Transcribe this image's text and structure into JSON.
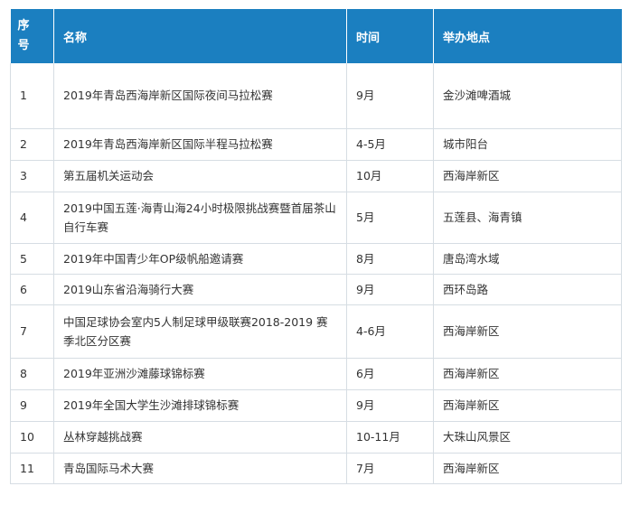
{
  "table": {
    "headers": [
      "序\n号",
      "名称",
      "时间",
      "举办地点"
    ],
    "rows": [
      {
        "no": "1",
        "name": "2019年青岛西海岸新区国际夜间马拉松赛",
        "time": "9月",
        "place": "金沙滩啤酒城"
      },
      {
        "no": "2",
        "name": "2019年青岛西海岸新区国际半程马拉松赛",
        "time": "4-5月",
        "place": "城市阳台"
      },
      {
        "no": "3",
        "name": "第五届机关运动会",
        "time": "10月",
        "place": "西海岸新区"
      },
      {
        "no": "4",
        "name": "2019中国五莲·海青山海24小时极限挑战赛暨首届茶山自行车赛",
        "time": "5月",
        "place": "五莲县、海青镇"
      },
      {
        "no": "5",
        "name": "2019年中国青少年OP级帆船邀请赛",
        "time": "8月",
        "place": "唐岛湾水域"
      },
      {
        "no": "6",
        "name": "2019山东省沿海骑行大赛",
        "time": "9月",
        "place": "西环岛路"
      },
      {
        "no": "7",
        "name": "中国足球协会室内5人制足球甲级联赛2018-2019 赛季北区分区赛",
        "time": "4-6月",
        "place": "西海岸新区"
      },
      {
        "no": "8",
        "name": "2019年亚洲沙滩藤球锦标赛",
        "time": "6月",
        "place": "西海岸新区"
      },
      {
        "no": "9",
        "name": "2019年全国大学生沙滩排球锦标赛",
        "time": "9月",
        "place": "西海岸新区"
      },
      {
        "no": "10",
        "name": "丛林穿越挑战赛",
        "time": "10-11月",
        "place": "大珠山风景区"
      },
      {
        "no": "11",
        "name": "青岛国际马术大赛",
        "time": "7月",
        "place": "西海岸新区"
      }
    ]
  },
  "colors": {
    "header_bg": "#1b7fc0",
    "header_text": "#ffffff",
    "border": "#d6dde3",
    "body_text": "#333333"
  }
}
